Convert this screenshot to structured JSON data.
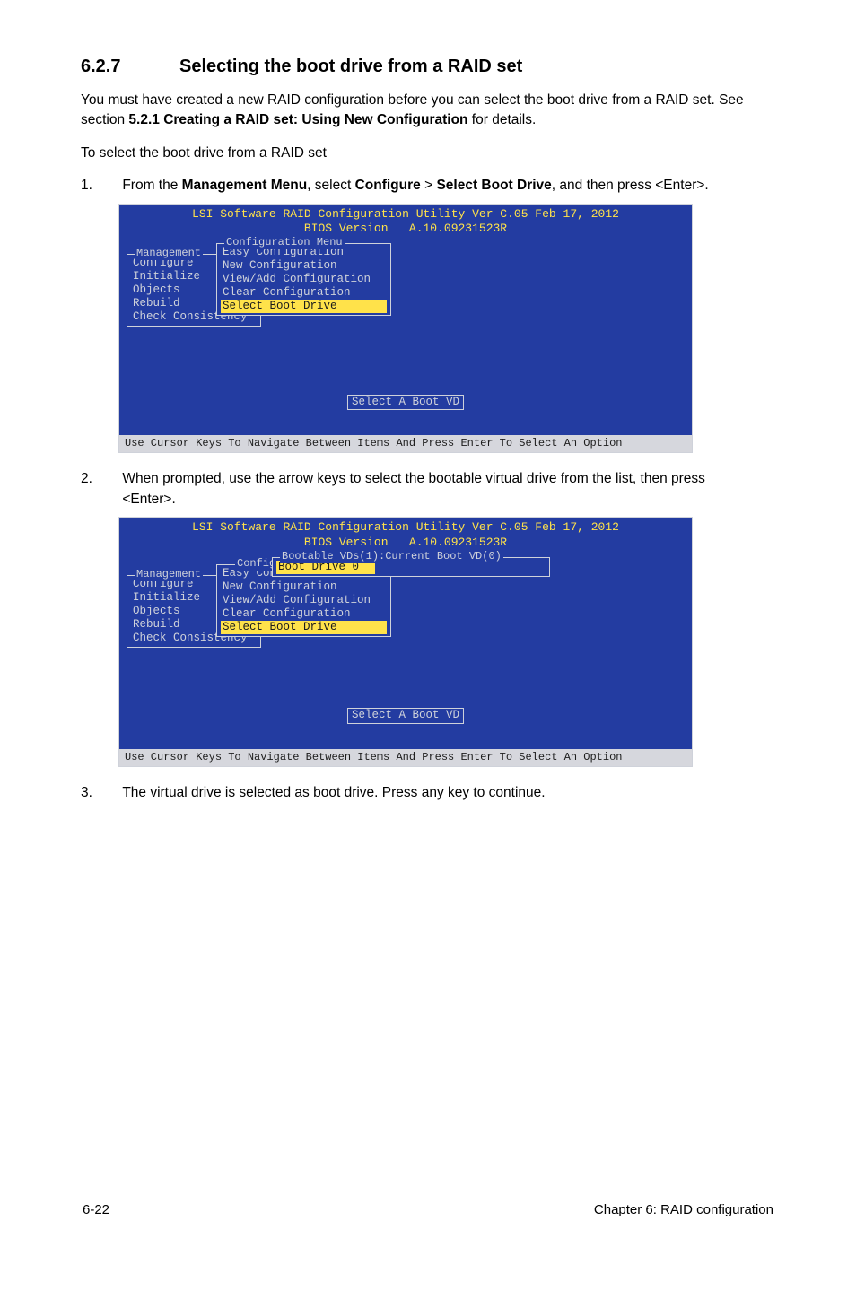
{
  "section": {
    "number": "6.2.7",
    "title": "Selecting the boot drive from a RAID set"
  },
  "intro": {
    "p1a": "You must have created a new RAID configuration before you can select the boot drive from a RAID set. See section ",
    "p1b": "5.2.1 Creating a RAID set: Using New Configuration",
    "p1c": " for details.",
    "p2": "To select the boot drive from a RAID set"
  },
  "steps": {
    "s1": {
      "n": "1.",
      "t1": "From the ",
      "t2": "Management Menu",
      "t3": ", select ",
      "t4": "Configure",
      "t5": " > ",
      "t6": "Select Boot Drive",
      "t7": ", and then press <Enter>."
    },
    "s2": {
      "n": "2.",
      "t": "When prompted, use the arrow keys to select the bootable virtual drive from the list, then press <Enter>."
    },
    "s3": {
      "n": "3.",
      "t": "The virtual drive is selected as boot drive. Press any key to continue."
    }
  },
  "bios1": {
    "header1": "LSI Software RAID Configuration Utility Ver C.05 Feb 17, 2012",
    "header2": "BIOS Version   A.10.09231523R",
    "mgmt_title": "Management",
    "mgmt_items": [
      "Configure",
      "Initialize",
      "Objects",
      "Rebuild",
      "Check Consistency"
    ],
    "cfg_title": "Configuration Menu",
    "cfg_items": [
      "Easy Configuration",
      "New Configuration",
      "View/Add Configuration",
      "Clear Configuration",
      "Select Boot Drive"
    ],
    "cfg_hl_index": 4,
    "bottom": "Select A Boot VD",
    "help": "Use Cursor Keys To Navigate Between Items And Press Enter To Select An Option"
  },
  "bios2": {
    "header1": "LSI Software RAID Configuration Utility Ver C.05 Feb 17, 2012",
    "header2": "BIOS Version   A.10.09231523R",
    "mgmt_title": "Management",
    "mgmt_items": [
      "Configure",
      "Initialize",
      "Objects",
      "Rebuild",
      "Check Consistency"
    ],
    "cfg_title": "Config",
    "cfg_items": [
      "Easy Con",
      "New Configuration",
      "View/Add Configuration",
      "Clear Configuration",
      "Select Boot Drive"
    ],
    "cfg_hl_index": 4,
    "boot_title": "Bootable VDs(1):Current Boot VD(0)",
    "boot_item": "Boot Drive 0",
    "bottom": "Select A Boot VD",
    "help": "Use Cursor Keys To Navigate Between Items And Press Enter To Select An Option"
  },
  "footer": {
    "left": "6-22",
    "right": "Chapter 6: RAID configuration"
  }
}
